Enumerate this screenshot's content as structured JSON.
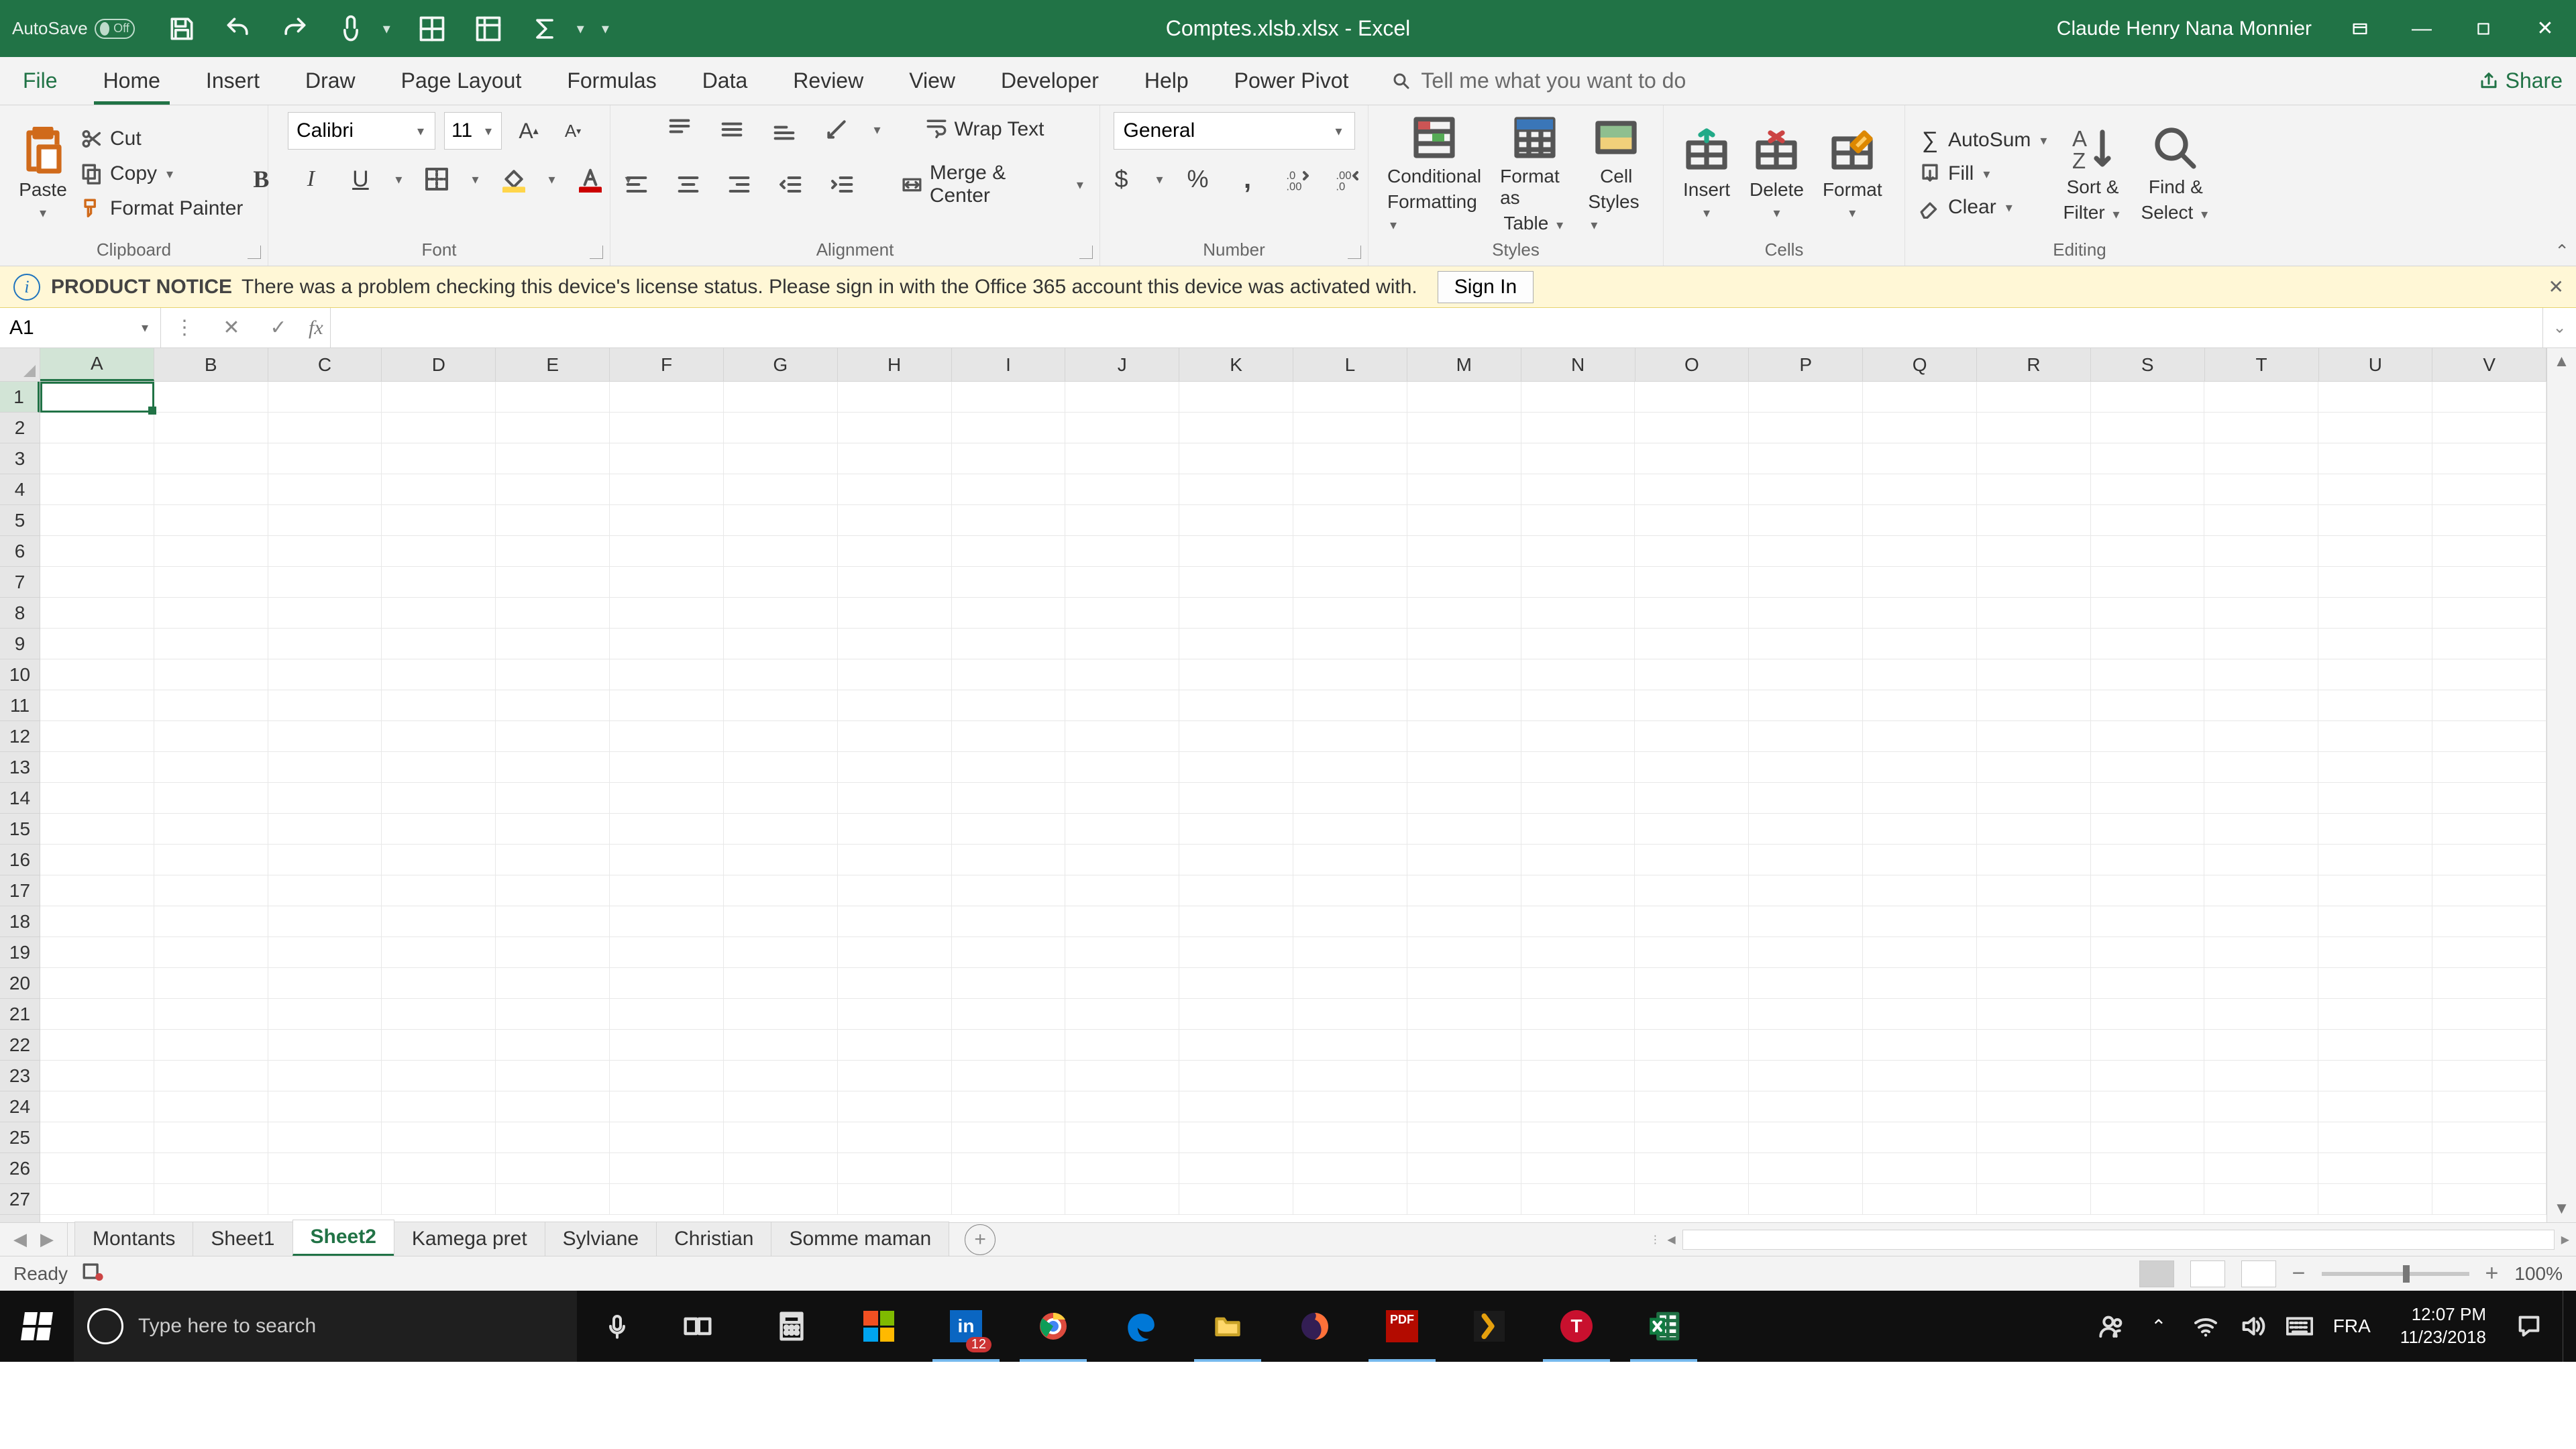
{
  "title": "Comptes.xlsb.xlsx  -  Excel",
  "user": "Claude Henry Nana Monnier",
  "autosave": {
    "label": "AutoSave",
    "state": "Off"
  },
  "tabs": [
    "File",
    "Home",
    "Insert",
    "Draw",
    "Page Layout",
    "Formulas",
    "Data",
    "Review",
    "View",
    "Developer",
    "Help",
    "Power Pivot"
  ],
  "active_tab": "Home",
  "tellme": "Tell me what you want to do",
  "share": "Share",
  "ribbon": {
    "clipboard": {
      "label": "Clipboard",
      "paste": "Paste",
      "cut": "Cut",
      "copy": "Copy",
      "painter": "Format Painter"
    },
    "font": {
      "label": "Font",
      "name": "Calibri",
      "size": "11"
    },
    "alignment": {
      "label": "Alignment",
      "wrap": "Wrap Text",
      "merge": "Merge & Center"
    },
    "number": {
      "label": "Number",
      "format": "General"
    },
    "styles": {
      "label": "Styles",
      "cond1": "Conditional",
      "cond2": "Formatting",
      "fat1": "Format as",
      "fat2": "Table",
      "cell1": "Cell",
      "cell2": "Styles"
    },
    "cells": {
      "label": "Cells",
      "insert": "Insert",
      "delete": "Delete",
      "format": "Format"
    },
    "editing": {
      "label": "Editing",
      "autosum": "AutoSum",
      "fill": "Fill",
      "clear": "Clear",
      "sort1": "Sort &",
      "sort2": "Filter",
      "find1": "Find &",
      "find2": "Select"
    }
  },
  "notice": {
    "label": "PRODUCT NOTICE",
    "text": "There was a problem checking this device's license status. Please sign in with the Office 365 account this device was activated with.",
    "button": "Sign In"
  },
  "namebox": "A1",
  "columns": [
    "A",
    "B",
    "C",
    "D",
    "E",
    "F",
    "G",
    "H",
    "I",
    "J",
    "K",
    "L",
    "M",
    "N",
    "O",
    "P",
    "Q",
    "R",
    "S",
    "T",
    "U",
    "V"
  ],
  "rows": 27,
  "selected": {
    "col": "A",
    "row": 1
  },
  "sheets": [
    "Montants",
    "Sheet1",
    "Sheet2",
    "Kamega pret",
    "Sylviane",
    "Christian",
    "Somme maman"
  ],
  "active_sheet": "Sheet2",
  "status": {
    "ready": "Ready",
    "zoom": "100%"
  },
  "taskbar": {
    "search_placeholder": "Type here to search",
    "lang": "FRA",
    "time": "12:07 PM",
    "date": "11/23/2018",
    "linkedin_badge": "12"
  }
}
